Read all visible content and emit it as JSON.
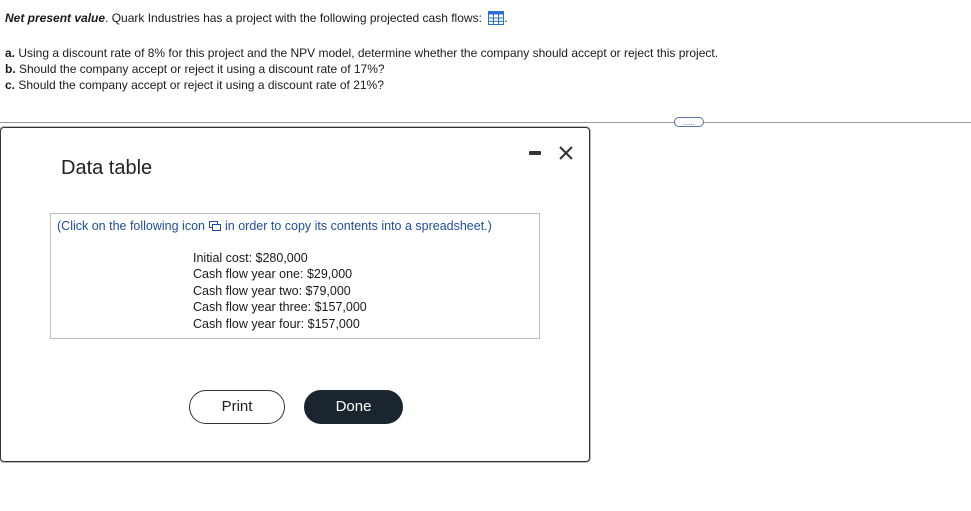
{
  "question": {
    "title_bold": "Net present value",
    "title_rest": ". Quark Industries has a project with the following projected cash flows:",
    "title_tail": ".",
    "a_label": "a.",
    "a_text": " Using a discount rate of 8% for this project and the NPV model, determine whether the company should accept or reject this project.",
    "b_label": "b.",
    "b_text": " Should the company accept or reject it using a discount rate of 17%?",
    "c_label": "c.",
    "c_text": " Should the company accept or reject it using a discount rate of 21%?"
  },
  "more_button": {
    "label": "....."
  },
  "modal": {
    "title": "Data table",
    "hint_before": "(Click on the following icon",
    "hint_after": "in order to copy its contents into a spreadsheet.)",
    "rows": [
      "Initial cost: $280,000",
      "Cash flow year one: $29,000",
      "Cash flow year two: $79,000",
      "Cash flow year three: $157,000",
      "Cash flow year four: $157,000"
    ],
    "print_label": "Print",
    "done_label": "Done"
  },
  "colors": {
    "link": "#1e4f9c",
    "done_bg": "#1b2530",
    "icon_blue": "#2a6fcf"
  },
  "icons": [
    "table-grid-icon",
    "minimize-icon",
    "close-icon",
    "copy-icon"
  ]
}
